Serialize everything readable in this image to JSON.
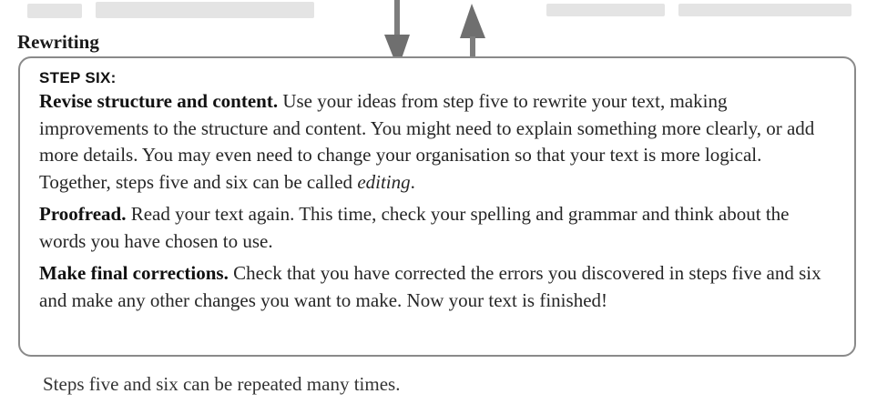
{
  "section_title": "Rewriting",
  "step": {
    "heading": "STEP SIX:",
    "paragraphs": [
      {
        "lead": "Revise structure and content.",
        "text_before": " Use your ideas from step five to rewrite your text, making improvements to the structure and content. You might need to explain something more clearly, or add more details. You may even need to change your organisation so that your text is more logical. Together, steps five and six can be called ",
        "emphasis": "editing",
        "text_after": "."
      },
      {
        "lead": "Proofread.",
        "text_before": " Read your text again. This time, check your spelling and grammar and think about the words you have chosen to use."
      },
      {
        "lead": "Make final corrections.",
        "text_before": " Check that you have corrected the errors you discovered in steps five and six and make any other changes you want to make. Now your text is finished!"
      }
    ]
  },
  "footer_note": "Steps five and six can be repeated many times.",
  "colors": {
    "box_border": "#8a8a8a",
    "arrow": "#7a7a7a"
  },
  "icons": {
    "down_arrow": "arrow-down-icon",
    "up_arrow": "arrow-up-icon"
  }
}
